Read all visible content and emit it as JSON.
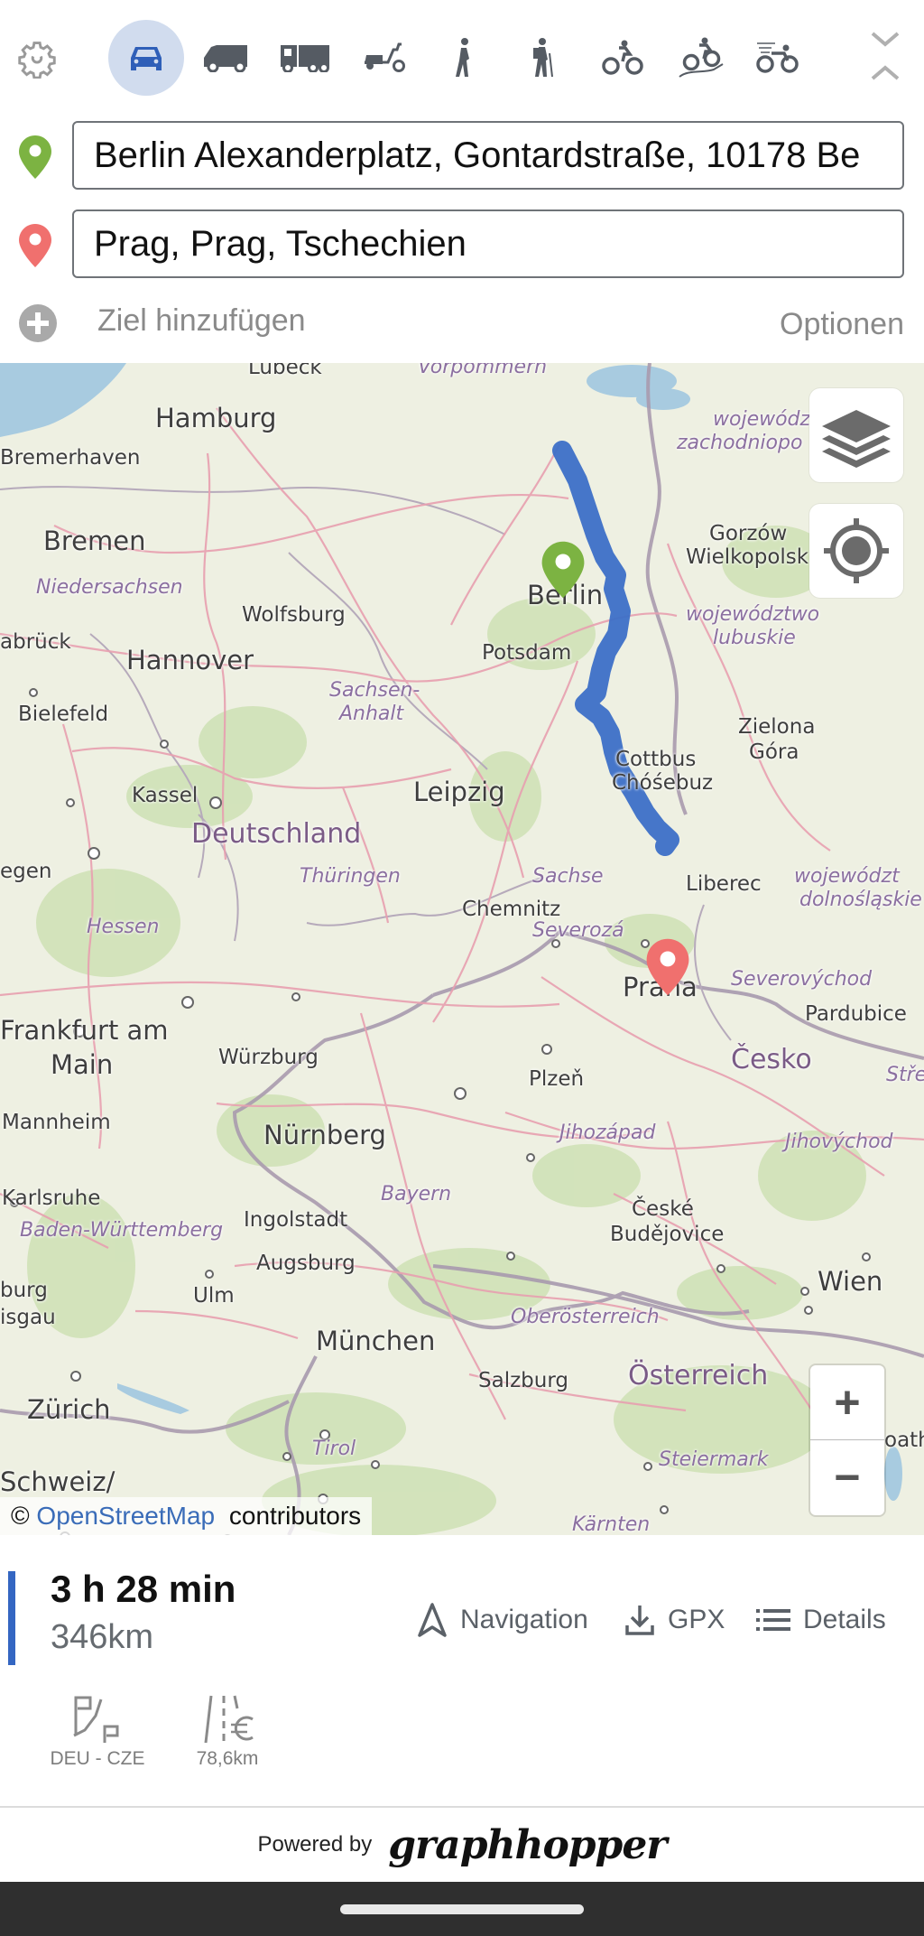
{
  "vehicles": {
    "settings_icon": "gear-icon",
    "items": [
      {
        "id": "car",
        "icon": "car-icon",
        "active": true
      },
      {
        "id": "small_truck",
        "icon": "van-icon",
        "active": false
      },
      {
        "id": "truck",
        "icon": "truck-icon",
        "active": false
      },
      {
        "id": "scooter",
        "icon": "scooter-icon",
        "active": false
      },
      {
        "id": "foot",
        "icon": "walking-icon",
        "active": false
      },
      {
        "id": "hike",
        "icon": "hiking-icon",
        "active": false
      },
      {
        "id": "bike",
        "icon": "bicycle-icon",
        "active": false
      },
      {
        "id": "mtb",
        "icon": "mountain-bike-icon",
        "active": false
      },
      {
        "id": "racingbike",
        "icon": "racing-bike-icon",
        "active": false
      }
    ],
    "active_color": "#2f5fb8",
    "active_bg": "#d1dcee"
  },
  "search": {
    "from": {
      "value": "Berlin Alexanderplatz, Gontardstraße, 10178 Be",
      "pin_color": "#7cb342"
    },
    "to": {
      "value": "Prag, Prag, Tschechien",
      "pin_color": "#f0706e"
    },
    "add_destination_label": "Ziel hinzufügen",
    "options_label": "Optionen"
  },
  "map": {
    "attribution_prefix": "©",
    "attribution_link": "OpenStreetMap",
    "attribution_suffix": "contributors",
    "zoom_in_label": "+",
    "zoom_out_label": "−",
    "route_color": "#3c6fc7",
    "labels": {
      "lubeck": "Lübeck",
      "vorpommern": "Vorpommern",
      "hamburg": "Hamburg",
      "bremerhaven": "Bremerhaven",
      "bremen": "Bremen",
      "niedersachsen": "Niedersachsen",
      "wolfsburg": "Wolfsburg",
      "osnabruck": "abrück",
      "hannover": "Hannover",
      "bielefeld": "Bielefeld",
      "sachsen_anhalt_1": "Sachsen-",
      "sachsen_anhalt_2": "Anhalt",
      "berlin": "Berlin",
      "potsdam": "Potsdam",
      "wojewodztwo_zach_1": "wojewódz",
      "wojewodztwo_zach_2": "zachodniopo",
      "gorzow_1": "Gorzów",
      "gorzow_2": "Wielkopolsk",
      "wojewodztwo_lub_1": "województwo",
      "wojewodztwo_lub_2": "lubuskie",
      "zielona_1": "Zielona",
      "zielona_2": "Góra",
      "cottbus_1": "Cottbus",
      "cottbus_2": "Chóśebuz",
      "kassel": "Kassel",
      "leipzig": "Leipzig",
      "deutschland": "Deutschland",
      "thuringen": "Thüringen",
      "sachsen": "Sachse",
      "chemnitz": "Chemnitz",
      "liberec": "Liberec",
      "wojewodztwo_dol_1": "województ",
      "wojewodztwo_dol_2": "dolnośląskie",
      "siegen": "egen",
      "hessen": "Hessen",
      "severozapad": "Severozá",
      "praha": "Praha",
      "severovychod": "Severovýchod",
      "pardubice": "Pardubice",
      "frankfurt_1": "Frankfurt am",
      "frankfurt_2": "Main",
      "wurzburg": "Würzburg",
      "plzen": "Plzeň",
      "cesko": "Česko",
      "stredni": "Stře",
      "mannheim": "Mannheim",
      "nurnberg": "Nürnberg",
      "jihozapad": "Jihozápad",
      "jihovychod": "Jihovýchod",
      "karlsruhe": "Karlsruhe",
      "bayern": "Bayern",
      "ceske_1": "České",
      "ceske_2": "Budějovice",
      "baden": "Baden-Württemberg",
      "ingolstadt": "Ingolstadt",
      "augsburg": "Augsburg",
      "freiburg_1": "burg",
      "freiburg_2": "isgau",
      "ulm": "Ulm",
      "wien": "Wien",
      "oberosterreich": "Oberösterreich",
      "munchen": "München",
      "zurich": "Zürich",
      "salzburg": "Salzburg",
      "osterreich": "Österreich",
      "tirol": "Tirol",
      "steiermark": "Steiermark",
      "schweiz": "Schweiz/",
      "karnten": "Kärnten",
      "szombathely": "oath"
    }
  },
  "route": {
    "duration": "3 h 28 min",
    "distance": "346km",
    "actions": [
      {
        "label": "Navigation",
        "icon": "navigation-arrow-icon"
      },
      {
        "label": "GPX",
        "icon": "download-icon"
      },
      {
        "label": "Details",
        "icon": "list-icon"
      }
    ],
    "stats": [
      {
        "label": "DEU - CZE",
        "icon": "border-crossing-icon"
      },
      {
        "label": "78,6km",
        "icon": "toll-road-icon"
      }
    ]
  },
  "footer": {
    "powered_by": "Powered by",
    "brand": "graphhopper"
  }
}
